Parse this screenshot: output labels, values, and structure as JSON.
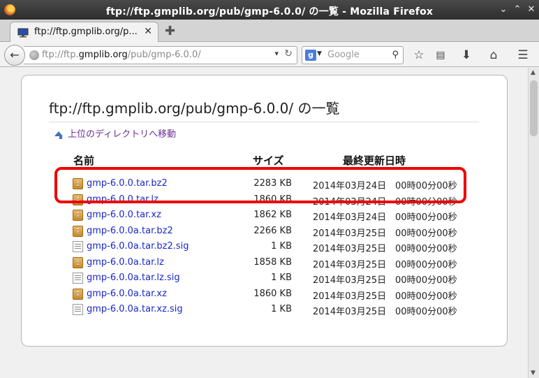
{
  "window": {
    "title": "ftp://ftp.gmplib.org/pub/gmp-6.0.0/ の一覧 - Mozilla Firefox",
    "minimize_glyph": "⌄",
    "maximize_glyph": "⌃",
    "close_glyph": "✕"
  },
  "tab": {
    "title": "ftp://ftp.gmplib.org/p...",
    "close_glyph": "✕",
    "new_tab_glyph": "✚"
  },
  "navbar": {
    "url_prefix": "ftp://ftp.",
    "url_host": "gmplib.org",
    "url_path": "/pub/gmp-6.0.0/",
    "search_engine_letter": "g",
    "search_placeholder": "Google",
    "icons": [
      "back-icon",
      "globe-icon",
      "reload-icon",
      "google-icon",
      "binoculars-icon",
      "bookmark-star-icon",
      "reading-list-icon",
      "download-icon",
      "home-icon",
      "menu-icon"
    ]
  },
  "page": {
    "heading": "ftp://ftp.gmplib.org/pub/gmp-6.0.0/ の一覧",
    "parent_link": "上位のディレクトリへ移動",
    "columns": {
      "name": "名前",
      "size": "サイズ",
      "modified": "最終更新日時"
    },
    "files": [
      {
        "name": "gmp-6.0.0.tar.bz2",
        "size": "2283 KB",
        "date": "2014年03月24日",
        "time": "00時00分00秒",
        "kind": "archive"
      },
      {
        "name": "gmp-6.0.0.tar.lz",
        "size": "1860 KB",
        "date": "2014年03月24日",
        "time": "00時00分00秒",
        "kind": "archive"
      },
      {
        "name": "gmp-6.0.0.tar.xz",
        "size": "1862 KB",
        "date": "2014年03月24日",
        "time": "00時00分00秒",
        "kind": "archive"
      },
      {
        "name": "gmp-6.0.0a.tar.bz2",
        "size": "2266 KB",
        "date": "2014年03月25日",
        "time": "00時00分00秒",
        "kind": "archive"
      },
      {
        "name": "gmp-6.0.0a.tar.bz2.sig",
        "size": "1 KB",
        "date": "2014年03月25日",
        "time": "00時00分00秒",
        "kind": "text"
      },
      {
        "name": "gmp-6.0.0a.tar.lz",
        "size": "1858 KB",
        "date": "2014年03月25日",
        "time": "00時00分00秒",
        "kind": "archive"
      },
      {
        "name": "gmp-6.0.0a.tar.lz.sig",
        "size": "1 KB",
        "date": "2014年03月25日",
        "time": "00時00分00秒",
        "kind": "text"
      },
      {
        "name": "gmp-6.0.0a.tar.xz",
        "size": "1860 KB",
        "date": "2014年03月25日",
        "time": "00時00分00秒",
        "kind": "archive"
      },
      {
        "name": "gmp-6.0.0a.tar.xz.sig",
        "size": "1 KB",
        "date": "2014年03月25日",
        "time": "00時00分00秒",
        "kind": "text"
      }
    ]
  },
  "colors": {
    "link": "#1a27c9",
    "visited_link": "#6a2f95",
    "highlight": "#ee0000"
  }
}
